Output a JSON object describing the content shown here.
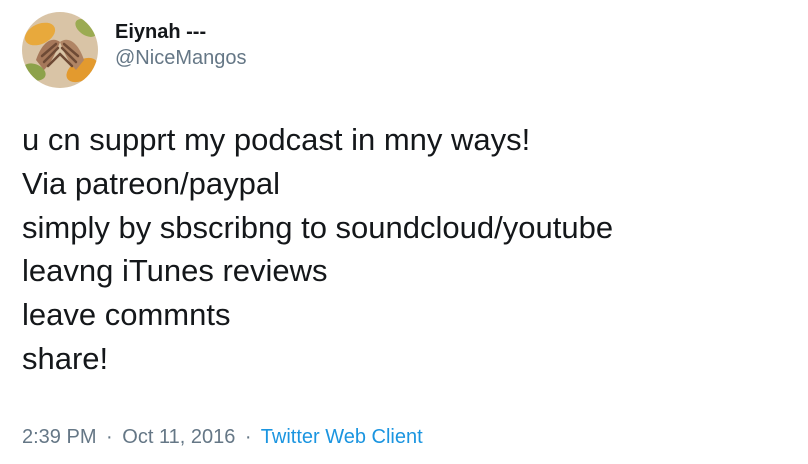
{
  "tweet": {
    "author": {
      "display_name": "Eiynah ---",
      "handle": "@NiceMangos",
      "avatar_icon": "avatar-hands-mangoes"
    },
    "lines": [
      "u cn supprt my podcast in mny ways!",
      "Via patreon/paypal",
      "simply by sbscribng to soundcloud/youtube",
      "leavng iTunes reviews",
      "leave commnts",
      "share!"
    ],
    "time": "2:39 PM",
    "separator": "·",
    "date": "Oct 11, 2016",
    "source": "Twitter Web Client"
  },
  "colors": {
    "text": "#14171a",
    "secondary": "#657786",
    "link": "#1b95e0"
  }
}
